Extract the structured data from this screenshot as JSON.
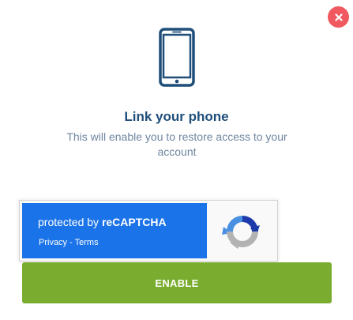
{
  "dialog": {
    "title": "Link your phone",
    "subtitle": "This will enable you to restore access to your account",
    "close_icon": "close-icon",
    "phone_icon": "smartphone-icon"
  },
  "recaptcha": {
    "protected_prefix": "protected by ",
    "brand": "reCAPTCHA",
    "privacy_label": "Privacy",
    "separator": " - ",
    "terms_label": "Terms",
    "logo_icon": "recaptcha-logo-icon"
  },
  "actions": {
    "enable_label": "ENABLE"
  },
  "colors": {
    "title": "#1f4e79",
    "subtitle": "#6f86a0",
    "close": "#f0595f",
    "recaptcha_blue": "#1a73e8",
    "enable_button": "#7aad2f"
  }
}
